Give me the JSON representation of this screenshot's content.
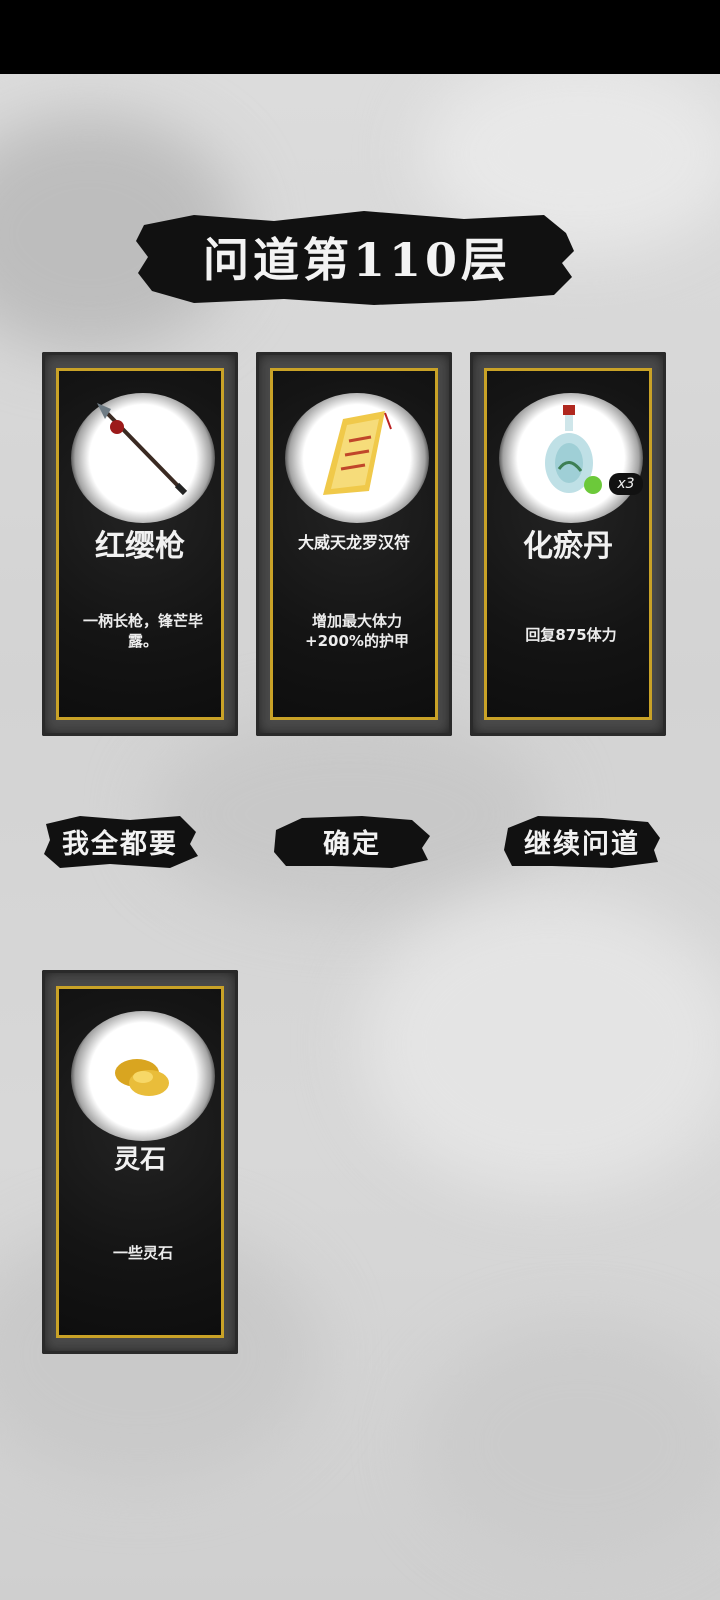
{
  "title": "问道第110层",
  "cards": [
    {
      "name": "红缨枪",
      "desc": "一柄长枪，锋芒毕露。",
      "icon": "spear-icon"
    },
    {
      "name": "大威天龙罗汉符",
      "desc": "增加最大体力+200%的护甲",
      "icon": "talisman-icon"
    },
    {
      "name": "化瘀丹",
      "desc": "回复875体力",
      "icon": "potion-bottle-icon",
      "qty": "x3"
    },
    {
      "name": "灵石",
      "desc": "一些灵石",
      "icon": "spirit-stone-icon"
    }
  ],
  "buttons": {
    "take_all": "我全都要",
    "confirm": "确定",
    "continue": "继续问道"
  },
  "colors": {
    "card_border": "#c9a227",
    "ink": "#111111",
    "background": "#d9d9d9"
  }
}
